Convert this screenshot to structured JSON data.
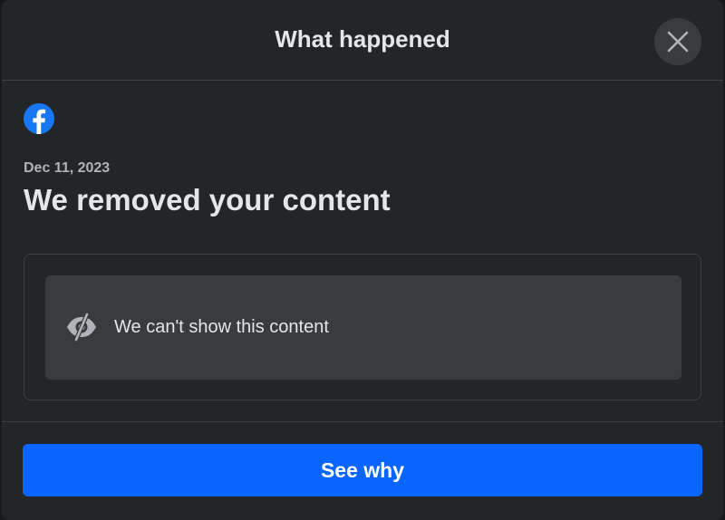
{
  "dialog": {
    "title": "What happened",
    "close_icon": "close-icon"
  },
  "brand": {
    "logo_icon": "facebook-logo-icon",
    "color": "#1877f2"
  },
  "notice": {
    "date": "Dec 11, 2023",
    "headline": "We removed your content"
  },
  "content_preview": {
    "icon": "eye-slash-icon",
    "message": "We can't show this content"
  },
  "actions": {
    "see_why_label": "See why",
    "accent_color": "#0866ff"
  }
}
